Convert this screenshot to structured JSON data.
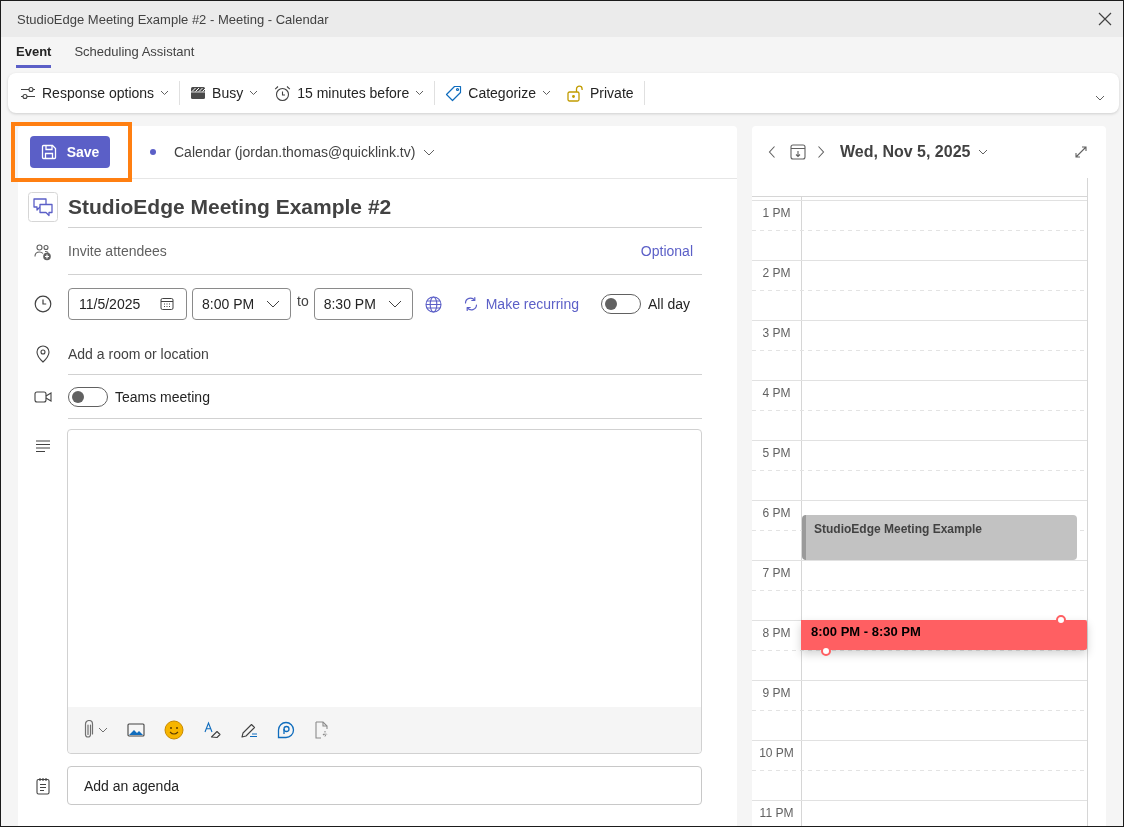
{
  "window": {
    "title": "StudioEdge Meeting Example #2 - Meeting - Calendar"
  },
  "tabs": [
    {
      "label": "Event",
      "selected": true
    },
    {
      "label": "Scheduling Assistant",
      "selected": false
    }
  ],
  "toolbar": {
    "groups": [
      {
        "items": [
          {
            "label": "Response options",
            "kind": "dropdown"
          }
        ]
      },
      {
        "items": [
          {
            "label": "Busy",
            "kind": "dropdown"
          },
          {
            "label": "15 minutes before",
            "kind": "dropdown"
          }
        ]
      },
      {
        "items": [
          {
            "label": "Categorize",
            "kind": "dropdown"
          },
          {
            "label": "Private",
            "kind": "button"
          }
        ]
      }
    ]
  },
  "save_button": {
    "label": "Save",
    "highlighted": true
  },
  "calendar_picker": {
    "label": "Calendar (jordan.thomas@quicklink.tv)"
  },
  "title": {
    "value": "StudioEdge Meeting Example #2"
  },
  "attendees": {
    "placeholder": "Invite attendees",
    "optional_link": "Optional"
  },
  "schedule": {
    "date": "11/5/2025",
    "start_time": "8:00 PM",
    "separator": "to",
    "end_time": "8:30 PM",
    "recurring_link": "Make recurring",
    "all_day": {
      "label": "All day",
      "on": false
    }
  },
  "location": {
    "placeholder": "Add a room or location"
  },
  "teams_meeting": {
    "label": "Teams meeting",
    "on": false
  },
  "agenda": {
    "placeholder": "Add an agenda"
  },
  "day_view": {
    "date": "Wed, Nov 5, 2025",
    "hours": [
      {
        "label": "1 PM"
      },
      {
        "label": "2 PM"
      },
      {
        "label": "3 PM"
      },
      {
        "label": "4 PM"
      },
      {
        "label": "5 PM"
      },
      {
        "label": "6 PM",
        "events": [
          {
            "title": "StudioEdge Meeting Example",
            "kind": "existing",
            "color": "#c2c2c2"
          }
        ]
      },
      {
        "label": "7 PM"
      },
      {
        "label": "8 PM",
        "events": [
          {
            "title": "8:00 PM - 8:30 PM",
            "kind": "draft",
            "color": "#ff5f62"
          }
        ]
      },
      {
        "label": "9 PM"
      },
      {
        "label": "10 PM"
      },
      {
        "label": "11 PM"
      }
    ]
  }
}
